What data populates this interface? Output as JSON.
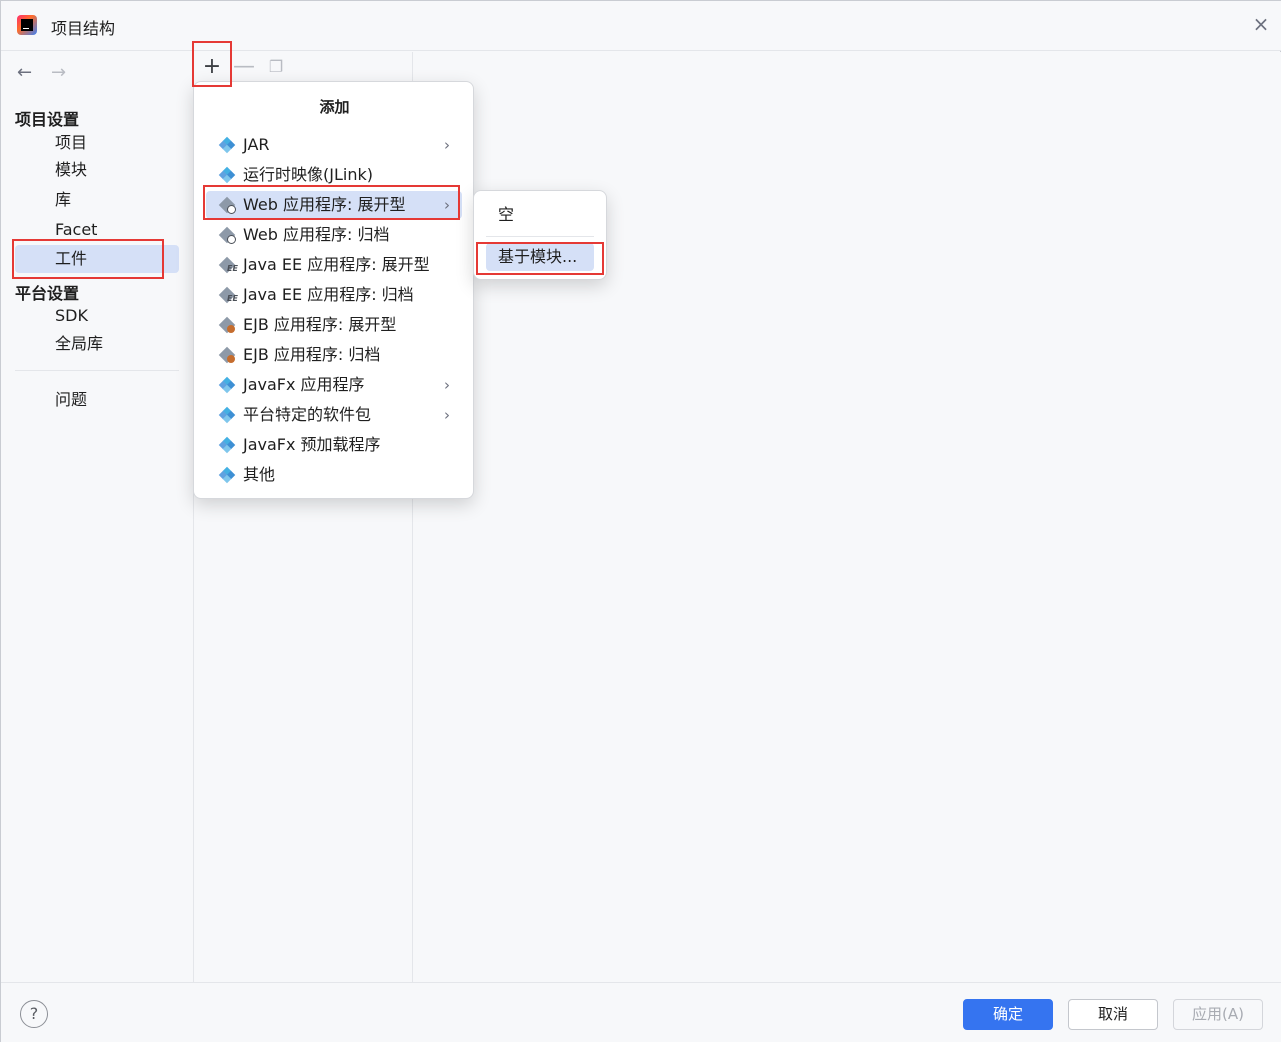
{
  "window": {
    "title": "项目结构"
  },
  "sidebar": {
    "project_settings_header": "项目设置",
    "project_items": [
      "项目",
      "模块",
      "库",
      "Facet",
      "工件"
    ],
    "platform_settings_header": "平台设置",
    "platform_items": [
      "SDK",
      "全局库"
    ],
    "problems": "问题"
  },
  "toolbar": {
    "add": "+",
    "remove": "—",
    "copy": "❐"
  },
  "add_menu": {
    "title": "添加",
    "items": [
      {
        "label": "JAR",
        "has_submenu": true
      },
      {
        "label": "运行时映像(JLink)",
        "has_submenu": false
      },
      {
        "label": "Web 应用程序: 展开型",
        "has_submenu": true
      },
      {
        "label": "Web 应用程序: 归档",
        "has_submenu": false
      },
      {
        "label": "Java EE 应用程序: 展开型",
        "has_submenu": false
      },
      {
        "label": "Java EE 应用程序: 归档",
        "has_submenu": false
      },
      {
        "label": "EJB 应用程序: 展开型",
        "has_submenu": false
      },
      {
        "label": "EJB 应用程序: 归档",
        "has_submenu": false
      },
      {
        "label": "JavaFx 应用程序",
        "has_submenu": true
      },
      {
        "label": "平台特定的软件包",
        "has_submenu": true
      },
      {
        "label": "JavaFx 预加载程序",
        "has_submenu": false
      },
      {
        "label": "其他",
        "has_submenu": false
      }
    ]
  },
  "submenu": {
    "items": [
      "空",
      "基于模块..."
    ]
  },
  "footer": {
    "help": "?",
    "ok": "确定",
    "cancel": "取消",
    "apply": "应用(A)"
  },
  "colors": {
    "accent": "#3574f0",
    "selection": "#d5e0f7",
    "annotation_box": "#e53935"
  }
}
